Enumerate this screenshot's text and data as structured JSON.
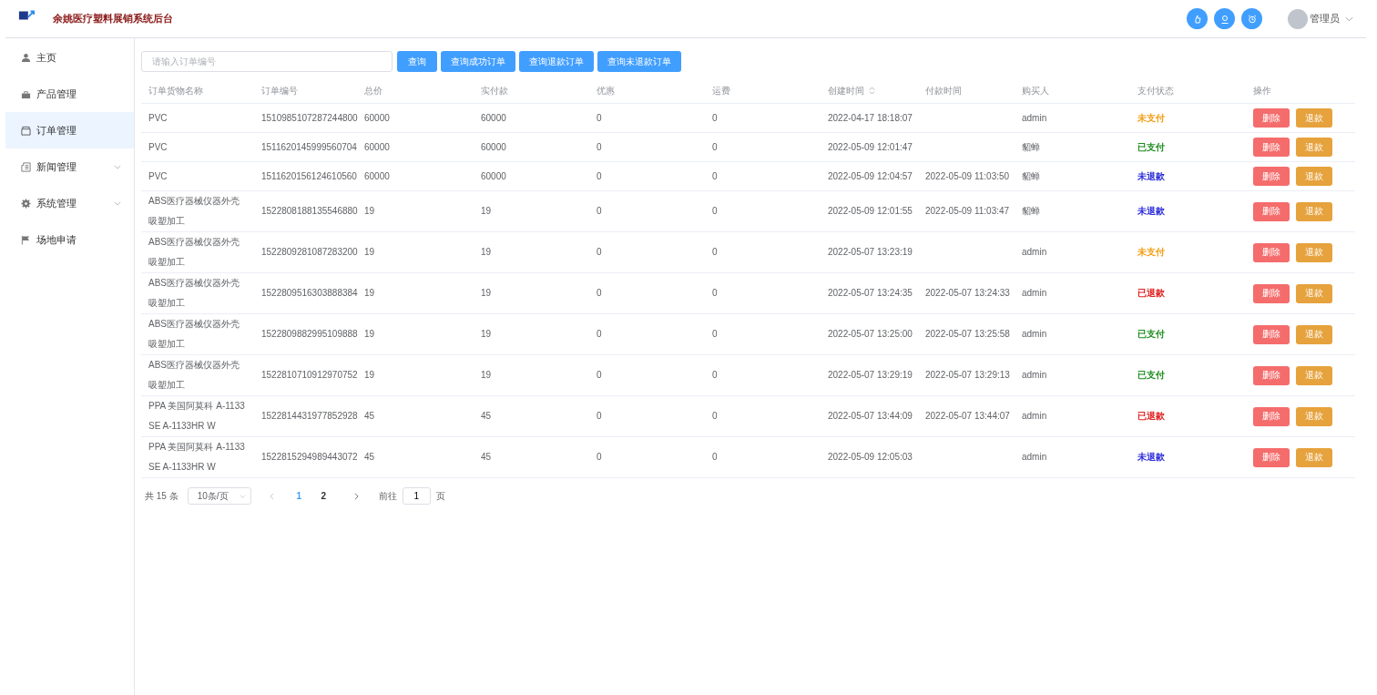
{
  "header": {
    "title": "余姚医疗塑料展销系统后台",
    "user": "管理员"
  },
  "sidebar": {
    "items": [
      {
        "label": "主页",
        "selected": false,
        "expandable": false
      },
      {
        "label": "产品管理",
        "selected": false,
        "expandable": false
      },
      {
        "label": "订单管理",
        "selected": true,
        "expandable": false
      },
      {
        "label": "新闻管理",
        "selected": false,
        "expandable": true
      },
      {
        "label": "系统管理",
        "selected": false,
        "expandable": true
      },
      {
        "label": "场地申请",
        "selected": false,
        "expandable": false
      }
    ]
  },
  "search": {
    "placeholder": "请输入订单编号"
  },
  "buttons": [
    "查询",
    "查询成功订单",
    "查询退款订单",
    "查询未退款订单"
  ],
  "table": {
    "columns": [
      {
        "label": "订单货物名称",
        "sortable": false
      },
      {
        "label": "订单编号",
        "sortable": false
      },
      {
        "label": "总价",
        "sortable": false
      },
      {
        "label": "实付款",
        "sortable": false
      },
      {
        "label": "优惠",
        "sortable": false
      },
      {
        "label": "运费",
        "sortable": false
      },
      {
        "label": "创建时间",
        "sortable": true
      },
      {
        "label": "付款时间",
        "sortable": false
      },
      {
        "label": "购买人",
        "sortable": false
      },
      {
        "label": "支付状态",
        "sortable": false
      },
      {
        "label": "操作",
        "sortable": false
      }
    ],
    "rows": [
      {
        "cells": [
          "PVC",
          "1510985107287244800",
          "60000",
          "60000",
          "0",
          "0",
          "2022-04-17 18:18:07",
          "",
          "admin"
        ],
        "status": "未支付",
        "color": "#f39c12",
        "actions": [
          {
            "label": "删除",
            "kind": "delete"
          },
          {
            "label": "退款",
            "kind": "refund"
          }
        ]
      },
      {
        "cells": [
          "PVC",
          "1511620145999560704",
          "60000",
          "60000",
          "0",
          "0",
          "2022-05-09 12:01:47",
          "",
          "貂蝉"
        ],
        "status": "已支付",
        "color": "#1e8c1e",
        "actions": [
          {
            "label": "删除",
            "kind": "delete"
          },
          {
            "label": "退款",
            "kind": "refund"
          }
        ]
      },
      {
        "cells": [
          "PVC",
          "1511620156124610560",
          "60000",
          "60000",
          "0",
          "0",
          "2022-05-09 12:04:57",
          "2022-05-09 11:03:50",
          "貂蝉"
        ],
        "status": "未退款",
        "color": "#2a2ad8",
        "actions": [
          {
            "label": "删除",
            "kind": "delete"
          },
          {
            "label": "退款",
            "kind": "refund"
          }
        ]
      },
      {
        "cells": [
          "ABS医疗器械仪器外壳吸塑加工",
          "1522808188135546880",
          "19",
          "19",
          "0",
          "0",
          "2022-05-09 12:01:55",
          "2022-05-09 11:03:47",
          "貂蝉"
        ],
        "status": "未退款",
        "color": "#2a2ad8",
        "actions": [
          {
            "label": "删除",
            "kind": "delete"
          },
          {
            "label": "退款",
            "kind": "refund"
          }
        ]
      },
      {
        "cells": [
          "ABS医疗器械仪器外壳吸塑加工",
          "1522809281087283200",
          "19",
          "19",
          "0",
          "0",
          "2022-05-07 13:23:19",
          "",
          "admin"
        ],
        "status": "未支付",
        "color": "#f39c12",
        "actions": [
          {
            "label": "删除",
            "kind": "delete"
          },
          {
            "label": "退款",
            "kind": "refund"
          }
        ]
      },
      {
        "cells": [
          "ABS医疗器械仪器外壳吸塑加工",
          "1522809516303888384",
          "19",
          "19",
          "0",
          "0",
          "2022-05-07 13:24:35",
          "2022-05-07 13:24:33",
          "admin"
        ],
        "status": "已退款",
        "color": "#e02020",
        "actions": [
          {
            "label": "删除",
            "kind": "delete"
          },
          {
            "label": "退款",
            "kind": "refund"
          }
        ]
      },
      {
        "cells": [
          "ABS医疗器械仪器外壳吸塑加工",
          "1522809882995109888",
          "19",
          "19",
          "0",
          "0",
          "2022-05-07 13:25:00",
          "2022-05-07 13:25:58",
          "admin"
        ],
        "status": "已支付",
        "color": "#1e8c1e",
        "actions": [
          {
            "label": "删除",
            "kind": "delete"
          },
          {
            "label": "退款",
            "kind": "refund"
          }
        ]
      },
      {
        "cells": [
          "ABS医疗器械仪器外壳吸塑加工",
          "1522810710912970752",
          "19",
          "19",
          "0",
          "0",
          "2022-05-07 13:29:19",
          "2022-05-07 13:29:13",
          "admin"
        ],
        "status": "已支付",
        "color": "#1e8c1e",
        "actions": [
          {
            "label": "删除",
            "kind": "delete"
          },
          {
            "label": "退款",
            "kind": "refund"
          }
        ]
      },
      {
        "cells": [
          "PPA 美国阿莫科 A-1133 SE A-1133HR W",
          "1522814431977852928",
          "45",
          "45",
          "0",
          "0",
          "2022-05-07 13:44:09",
          "2022-05-07 13:44:07",
          "admin"
        ],
        "status": "已退款",
        "color": "#e02020",
        "actions": [
          {
            "label": "删除",
            "kind": "delete"
          },
          {
            "label": "退款",
            "kind": "refund"
          }
        ]
      },
      {
        "cells": [
          "PPA 美国阿莫科 A-1133 SE A-1133HR W",
          "1522815294989443072",
          "45",
          "45",
          "0",
          "0",
          "2022-05-09 12:05:03",
          "",
          "admin"
        ],
        "status": "未退款",
        "color": "#2a2ad8",
        "actions": [
          {
            "label": "删除",
            "kind": "delete"
          },
          {
            "label": "退款",
            "kind": "refund"
          }
        ]
      }
    ]
  },
  "pagination": {
    "total": "共 15 条",
    "page_size": "10条/页",
    "pages": [
      {
        "label": "1",
        "selected": true
      },
      {
        "label": "2",
        "selected": false
      }
    ],
    "goto_label": "前往",
    "goto_value": "1",
    "goto_suffix": "页"
  }
}
